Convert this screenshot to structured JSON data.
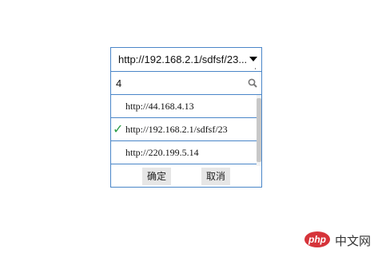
{
  "select": {
    "selected_value": "http://192.168.2.1/sdfsf/23...",
    "search_value": "4",
    "options": [
      {
        "label": "http://44.168.4.13",
        "checked": false
      },
      {
        "label": "http://192.168.2.1/sdfsf/23",
        "checked": true
      },
      {
        "label": "http://220.199.5.14",
        "checked": false
      }
    ],
    "check_mark": "✓",
    "check_color": "#2a9c45",
    "border_color": "#4a86c8"
  },
  "buttons": {
    "ok_label": "确定",
    "cancel_label": "取消"
  },
  "watermark": {
    "badge": "php",
    "text": "中文网"
  }
}
